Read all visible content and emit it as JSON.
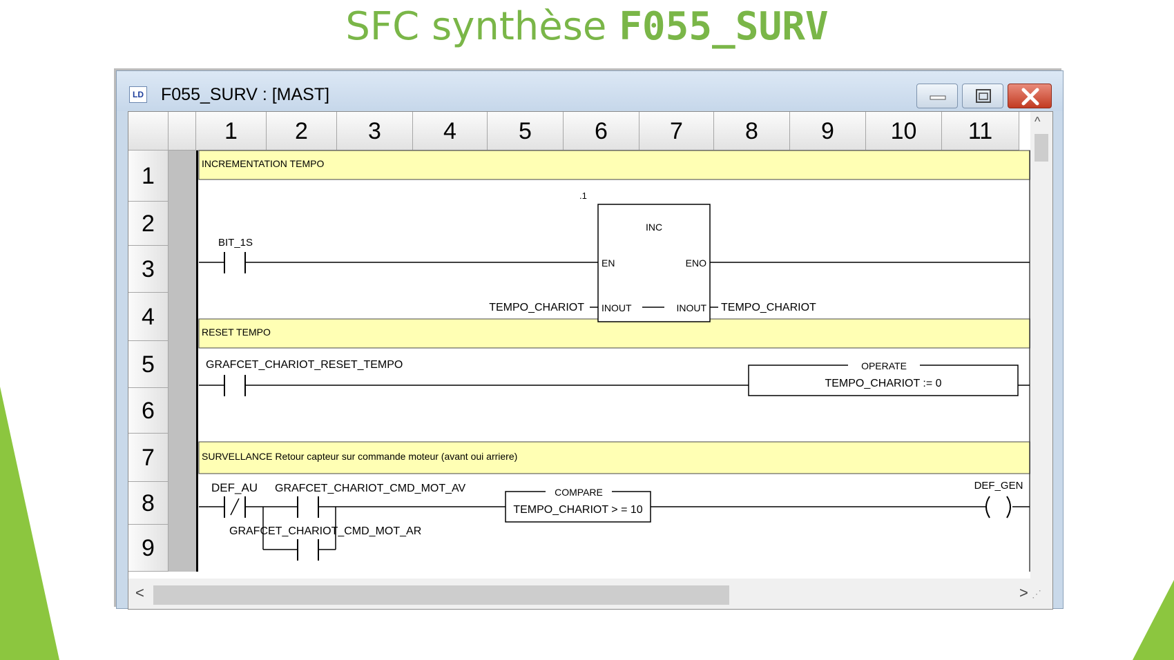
{
  "slide": {
    "title_prefix": "SFC synthèse ",
    "title_bold": "F055_SURV",
    "accent_color": "#7ab648"
  },
  "window": {
    "title": "F055_SURV : [MAST]",
    "app_icon_text": "LD",
    "icons": [
      "ld-app-icon",
      "minimize-icon",
      "maximize-icon",
      "close-icon"
    ]
  },
  "grid": {
    "columns": [
      "1",
      "2",
      "3",
      "4",
      "5",
      "6",
      "7",
      "8",
      "9",
      "10",
      "11"
    ],
    "rows": [
      "1",
      "2",
      "3",
      "4",
      "5",
      "6",
      "7",
      "8",
      "9"
    ]
  },
  "ladder": {
    "rung1": {
      "comment": "INCREMENTATION TEMPO",
      "contact": "BIT_1S",
      "block_index": ".1",
      "block_name": "INC",
      "pin_en": "EN",
      "pin_eno": "ENO",
      "pin_inout_in": "INOUT",
      "pin_inout_out": "INOUT",
      "var_in": "TEMPO_CHARIOT",
      "var_out": "TEMPO_CHARIOT"
    },
    "rung2": {
      "comment": "RESET TEMPO",
      "contact": "GRAFCET_CHARIOT_RESET_TEMPO",
      "op_title": "OPERATE",
      "op_expr": "TEMPO_CHARIOT := 0"
    },
    "rung3": {
      "comment": "SURVELLANCE Retour capteur sur commande moteur (avant oui arriere)",
      "contact_nc": "DEF_AU",
      "contact_av": "GRAFCET_CHARIOT_CMD_MOT_AV",
      "contact_ar": "GRAFCET_CHARIOT_CMD_MOT_AR",
      "cmp_title": "COMPARE",
      "cmp_expr": "TEMPO_CHARIOT > = 10",
      "coil": "DEF_GEN"
    }
  },
  "scroll": {
    "up": "^",
    "left": "<",
    "right": ">"
  }
}
